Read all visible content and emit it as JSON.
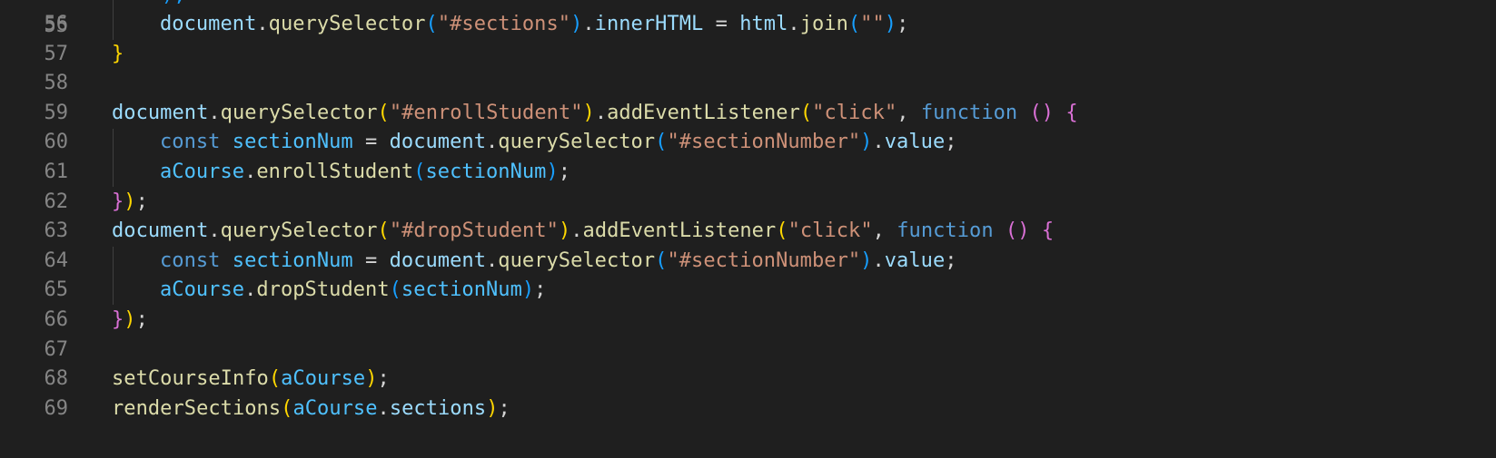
{
  "editor": {
    "theme_colors": {
      "background": "#1f1f1f",
      "line_number": "#858585",
      "variable": "#9cdcfe",
      "function": "#dcdcaa",
      "string": "#ce9178",
      "keyword": "#569cd6",
      "bracket_level_1": "#ffd700",
      "bracket_level_2": "#da70d6",
      "bracket_level_3": "#179fff"
    },
    "partial_top_line": {
      "number": "55",
      "text": ");"
    },
    "lines": [
      {
        "number": "56",
        "indent": 1,
        "tokens": [
          {
            "t": "document",
            "c": "t-var"
          },
          {
            "t": ".",
            "c": "t-punc"
          },
          {
            "t": "querySelector",
            "c": "t-fn"
          },
          {
            "t": "(",
            "c": "t-b3"
          },
          {
            "t": "\"#sections\"",
            "c": "t-str"
          },
          {
            "t": ")",
            "c": "t-b3"
          },
          {
            "t": ".",
            "c": "t-punc"
          },
          {
            "t": "innerHTML",
            "c": "t-var"
          },
          {
            "t": " = ",
            "c": "t-op"
          },
          {
            "t": "html",
            "c": "t-var"
          },
          {
            "t": ".",
            "c": "t-punc"
          },
          {
            "t": "join",
            "c": "t-fn"
          },
          {
            "t": "(",
            "c": "t-b3"
          },
          {
            "t": "\"\"",
            "c": "t-str"
          },
          {
            "t": ")",
            "c": "t-b3"
          },
          {
            "t": ";",
            "c": "t-punc"
          }
        ]
      },
      {
        "number": "57",
        "indent": 0,
        "tokens": [
          {
            "t": "}",
            "c": "t-b1"
          }
        ]
      },
      {
        "number": "58",
        "indent": 0,
        "tokens": []
      },
      {
        "number": "59",
        "indent": 0,
        "tokens": [
          {
            "t": "document",
            "c": "t-var"
          },
          {
            "t": ".",
            "c": "t-punc"
          },
          {
            "t": "querySelector",
            "c": "t-fn"
          },
          {
            "t": "(",
            "c": "t-b1"
          },
          {
            "t": "\"#enrollStudent\"",
            "c": "t-str"
          },
          {
            "t": ")",
            "c": "t-b1"
          },
          {
            "t": ".",
            "c": "t-punc"
          },
          {
            "t": "addEventListener",
            "c": "t-fn"
          },
          {
            "t": "(",
            "c": "t-b1"
          },
          {
            "t": "\"click\"",
            "c": "t-str"
          },
          {
            "t": ", ",
            "c": "t-punc"
          },
          {
            "t": "function",
            "c": "t-kw"
          },
          {
            "t": " ",
            "c": "t-punc"
          },
          {
            "t": "()",
            "c": "t-b2"
          },
          {
            "t": " ",
            "c": "t-punc"
          },
          {
            "t": "{",
            "c": "t-b2"
          }
        ]
      },
      {
        "number": "60",
        "indent": 1,
        "tokens": [
          {
            "t": "const",
            "c": "t-kw"
          },
          {
            "t": " ",
            "c": "t-punc"
          },
          {
            "t": "sectionNum",
            "c": "t-const"
          },
          {
            "t": " = ",
            "c": "t-op"
          },
          {
            "t": "document",
            "c": "t-var"
          },
          {
            "t": ".",
            "c": "t-punc"
          },
          {
            "t": "querySelector",
            "c": "t-fn"
          },
          {
            "t": "(",
            "c": "t-b3"
          },
          {
            "t": "\"#sectionNumber\"",
            "c": "t-str"
          },
          {
            "t": ")",
            "c": "t-b3"
          },
          {
            "t": ".",
            "c": "t-punc"
          },
          {
            "t": "value",
            "c": "t-var"
          },
          {
            "t": ";",
            "c": "t-punc"
          }
        ]
      },
      {
        "number": "61",
        "indent": 1,
        "tokens": [
          {
            "t": "aCourse",
            "c": "t-const"
          },
          {
            "t": ".",
            "c": "t-punc"
          },
          {
            "t": "enrollStudent",
            "c": "t-fn"
          },
          {
            "t": "(",
            "c": "t-b3"
          },
          {
            "t": "sectionNum",
            "c": "t-const"
          },
          {
            "t": ")",
            "c": "t-b3"
          },
          {
            "t": ";",
            "c": "t-punc"
          }
        ]
      },
      {
        "number": "62",
        "indent": 0,
        "tokens": [
          {
            "t": "}",
            "c": "t-b2"
          },
          {
            "t": ")",
            "c": "t-b1"
          },
          {
            "t": ";",
            "c": "t-punc"
          }
        ]
      },
      {
        "number": "63",
        "indent": 0,
        "tokens": [
          {
            "t": "document",
            "c": "t-var"
          },
          {
            "t": ".",
            "c": "t-punc"
          },
          {
            "t": "querySelector",
            "c": "t-fn"
          },
          {
            "t": "(",
            "c": "t-b1"
          },
          {
            "t": "\"#dropStudent\"",
            "c": "t-str"
          },
          {
            "t": ")",
            "c": "t-b1"
          },
          {
            "t": ".",
            "c": "t-punc"
          },
          {
            "t": "addEventListener",
            "c": "t-fn"
          },
          {
            "t": "(",
            "c": "t-b1"
          },
          {
            "t": "\"click\"",
            "c": "t-str"
          },
          {
            "t": ", ",
            "c": "t-punc"
          },
          {
            "t": "function",
            "c": "t-kw"
          },
          {
            "t": " ",
            "c": "t-punc"
          },
          {
            "t": "()",
            "c": "t-b2"
          },
          {
            "t": " ",
            "c": "t-punc"
          },
          {
            "t": "{",
            "c": "t-b2"
          }
        ]
      },
      {
        "number": "64",
        "indent": 1,
        "tokens": [
          {
            "t": "const",
            "c": "t-kw"
          },
          {
            "t": " ",
            "c": "t-punc"
          },
          {
            "t": "sectionNum",
            "c": "t-const"
          },
          {
            "t": " = ",
            "c": "t-op"
          },
          {
            "t": "document",
            "c": "t-var"
          },
          {
            "t": ".",
            "c": "t-punc"
          },
          {
            "t": "querySelector",
            "c": "t-fn"
          },
          {
            "t": "(",
            "c": "t-b3"
          },
          {
            "t": "\"#sectionNumber\"",
            "c": "t-str"
          },
          {
            "t": ")",
            "c": "t-b3"
          },
          {
            "t": ".",
            "c": "t-punc"
          },
          {
            "t": "value",
            "c": "t-var"
          },
          {
            "t": ";",
            "c": "t-punc"
          }
        ]
      },
      {
        "number": "65",
        "indent": 1,
        "tokens": [
          {
            "t": "aCourse",
            "c": "t-const"
          },
          {
            "t": ".",
            "c": "t-punc"
          },
          {
            "t": "dropStudent",
            "c": "t-fn"
          },
          {
            "t": "(",
            "c": "t-b3"
          },
          {
            "t": "sectionNum",
            "c": "t-const"
          },
          {
            "t": ")",
            "c": "t-b3"
          },
          {
            "t": ";",
            "c": "t-punc"
          }
        ]
      },
      {
        "number": "66",
        "indent": 0,
        "tokens": [
          {
            "t": "}",
            "c": "t-b2"
          },
          {
            "t": ")",
            "c": "t-b1"
          },
          {
            "t": ";",
            "c": "t-punc"
          }
        ]
      },
      {
        "number": "67",
        "indent": 0,
        "tokens": []
      },
      {
        "number": "68",
        "indent": 0,
        "tokens": [
          {
            "t": "setCourseInfo",
            "c": "t-fn"
          },
          {
            "t": "(",
            "c": "t-b1"
          },
          {
            "t": "aCourse",
            "c": "t-const"
          },
          {
            "t": ")",
            "c": "t-b1"
          },
          {
            "t": ";",
            "c": "t-punc"
          }
        ]
      },
      {
        "number": "69",
        "indent": 0,
        "tokens": [
          {
            "t": "renderSections",
            "c": "t-fn"
          },
          {
            "t": "(",
            "c": "t-b1"
          },
          {
            "t": "aCourse",
            "c": "t-const"
          },
          {
            "t": ".",
            "c": "t-punc"
          },
          {
            "t": "sections",
            "c": "t-var"
          },
          {
            "t": ")",
            "c": "t-b1"
          },
          {
            "t": ";",
            "c": "t-punc"
          }
        ]
      }
    ]
  }
}
